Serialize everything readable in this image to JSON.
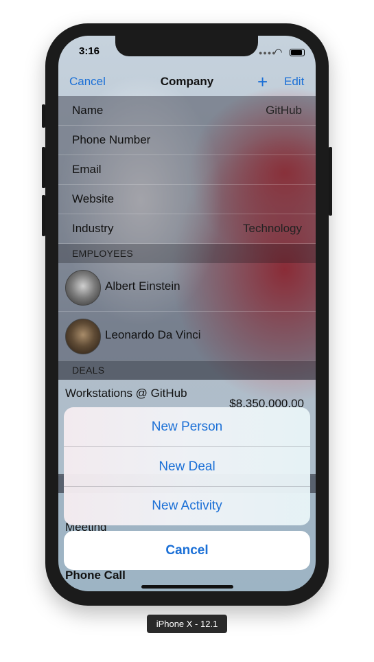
{
  "status": {
    "time": "3:16"
  },
  "nav": {
    "cancel": "Cancel",
    "title": "Company",
    "add_symbol": "+",
    "edit": "Edit"
  },
  "company": {
    "fields": [
      {
        "label": "Name",
        "value": "GitHub"
      },
      {
        "label": "Phone Number",
        "value": ""
      },
      {
        "label": "Email",
        "value": ""
      },
      {
        "label": "Website",
        "value": ""
      },
      {
        "label": "Industry",
        "value": "Technology"
      }
    ]
  },
  "employees": {
    "header": "EMPLOYEES",
    "items": [
      {
        "name": "Albert Einstein"
      },
      {
        "name": "Leonardo Da Vinci"
      }
    ]
  },
  "deals": {
    "header": "DEALS",
    "items": [
      {
        "name": "Workstations @ GitHub",
        "amount": "$8,350,000.00"
      }
    ]
  },
  "activities": {
    "items": [
      {
        "name": "Meeting"
      },
      {
        "name": "Phone Call"
      }
    ]
  },
  "action_sheet": {
    "options": [
      "New Person",
      "New Deal",
      "New Activity"
    ],
    "cancel": "Cancel"
  },
  "device_caption": "iPhone X - 12.1",
  "colors": {
    "accent": "#1a6fd6"
  }
}
